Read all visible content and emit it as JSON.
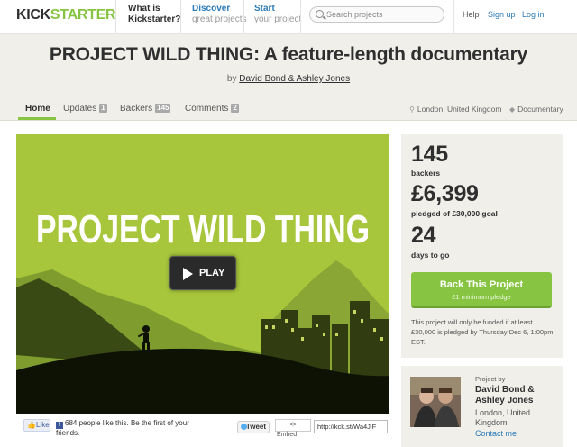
{
  "nav": {
    "logo_part1": "KICK",
    "logo_part2": "STARTER",
    "what_is": "What is",
    "what_is_2": "Kickstarter?",
    "discover": "Discover",
    "discover_sub": "great projects",
    "start": "Start",
    "start_sub": "your project",
    "search_placeholder": "Search projects",
    "help": "Help",
    "signup": "Sign up",
    "login": "Log in"
  },
  "project": {
    "title": "PROJECT WILD THING: A feature-length documentary",
    "by_prefix": "by",
    "creators": "David Bond & Ashley Jones"
  },
  "tabs": [
    {
      "label": "Home",
      "active": true
    },
    {
      "label": "Updates",
      "count": "1"
    },
    {
      "label": "Backers",
      "count": "145"
    },
    {
      "label": "Comments",
      "count": "2"
    }
  ],
  "meta": {
    "location": "London, United Kingdom",
    "category": "Documentary"
  },
  "video": {
    "poster_title": "PROJECT WILD THING",
    "play_label": "PLAY"
  },
  "share": {
    "like_label": "Like",
    "fb_text": "684 people like this. Be the first of your friends.",
    "tweet_label": "Tweet",
    "embed_icon": "<>",
    "embed_label": "Embed",
    "short_url": "http://kck.st/Wa4JjF"
  },
  "stats": {
    "backers_count": "145",
    "backers_label": "backers",
    "pledged_amount": "£6,399",
    "pledged_label": "pledged of £30,000 goal",
    "days_count": "24",
    "days_label": "days to go",
    "back_button": "Back This Project",
    "min_pledge": "£1 minimum pledge",
    "funding_note": "This project will only be funded if at least £30,000 is pledged by Thursday Dec 6, 1:00pm EST."
  },
  "creator": {
    "project_by": "Project by",
    "name": "David Bond & Ashley Jones",
    "location": "London, United Kingdom",
    "contact": "Contact me"
  },
  "colors": {
    "brand_green": "#87c442",
    "link_blue": "#2b7bb9",
    "video_green": "#a6c53b"
  }
}
